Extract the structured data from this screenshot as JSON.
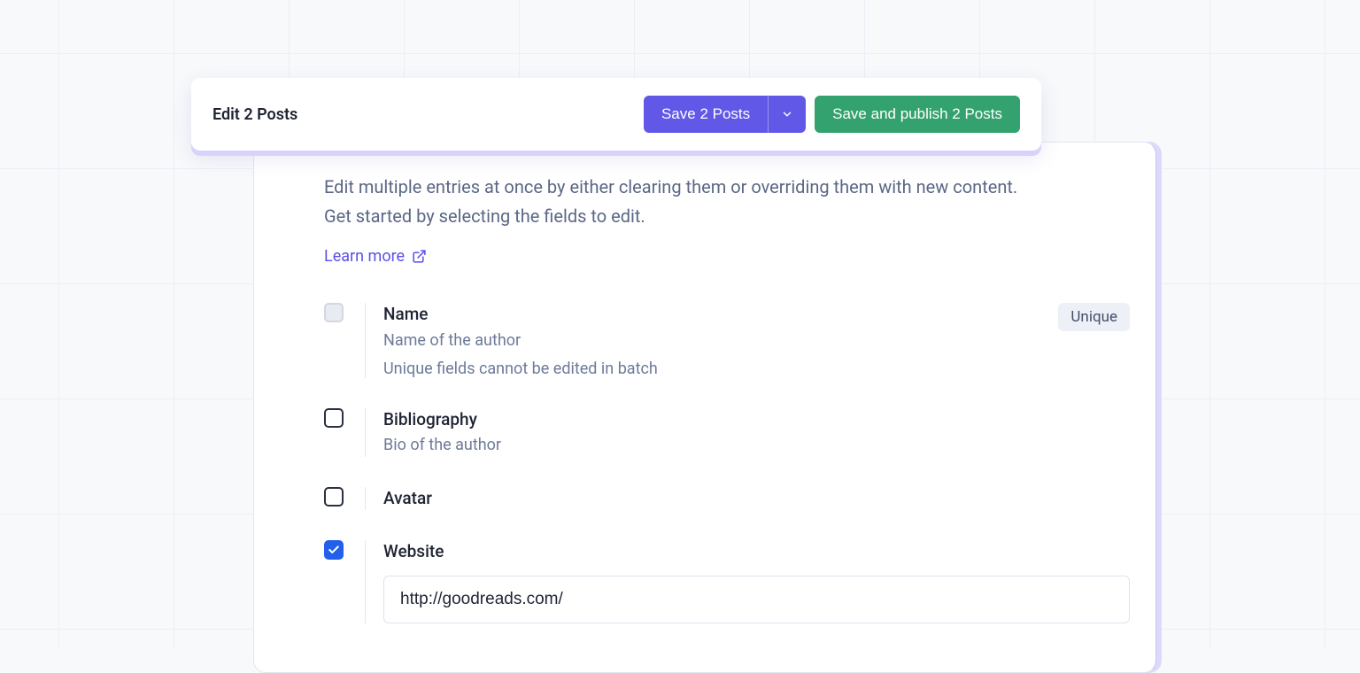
{
  "header": {
    "title": "Edit 2 Posts",
    "save_label": "Save 2 Posts",
    "publish_label": "Save and publish 2 Posts"
  },
  "intro": "Edit multiple entries at once by either clearing them or overriding them with new content. Get started by selecting the fields to edit.",
  "learn_more": "Learn more",
  "fields": {
    "name": {
      "title": "Name",
      "subtitle": "Name of the author",
      "note": "Unique fields cannot be edited in batch",
      "badge": "Unique"
    },
    "bibliography": {
      "title": "Bibliography",
      "subtitle": "Bio of the author"
    },
    "avatar": {
      "title": "Avatar"
    },
    "website": {
      "title": "Website",
      "value": "http://goodreads.com/"
    }
  }
}
